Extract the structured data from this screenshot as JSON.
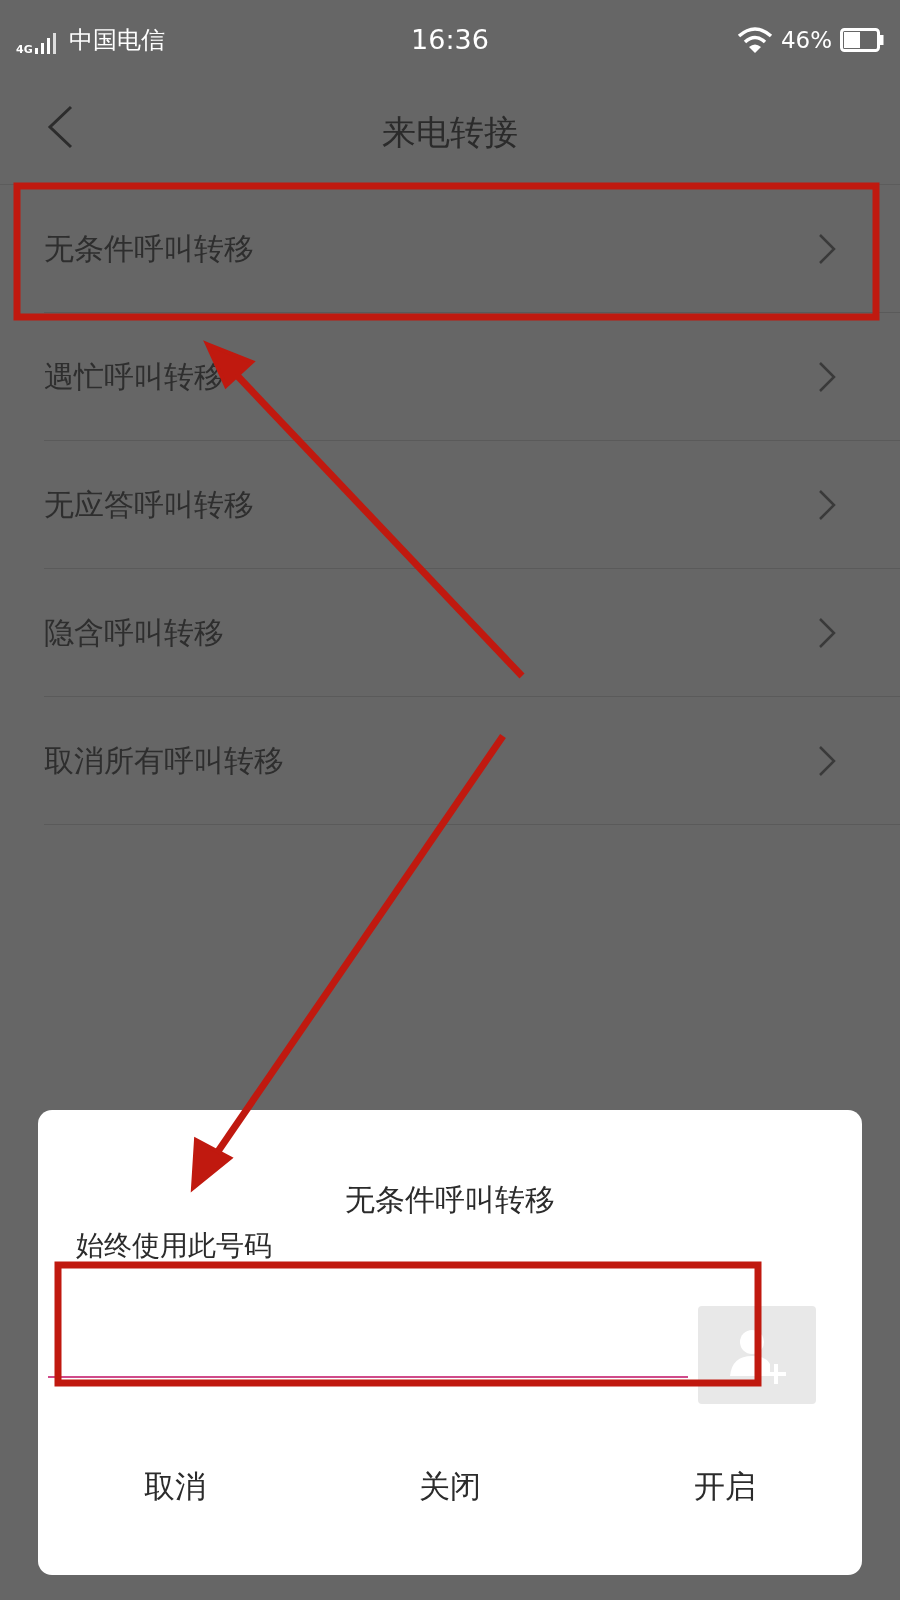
{
  "status_bar": {
    "network": "4G",
    "carrier": "中国电信",
    "time": "16:36",
    "battery": "46%"
  },
  "header": {
    "title": "来电转接"
  },
  "items": [
    {
      "label": "无条件呼叫转移"
    },
    {
      "label": "遇忙呼叫转移"
    },
    {
      "label": "无应答呼叫转移"
    },
    {
      "label": "隐含呼叫转移"
    },
    {
      "label": "取消所有呼叫转移"
    }
  ],
  "dialog": {
    "title": "无条件呼叫转移",
    "field_label": "始终使用此号码",
    "buttons": [
      "取消",
      "关闭",
      "开启"
    ]
  }
}
